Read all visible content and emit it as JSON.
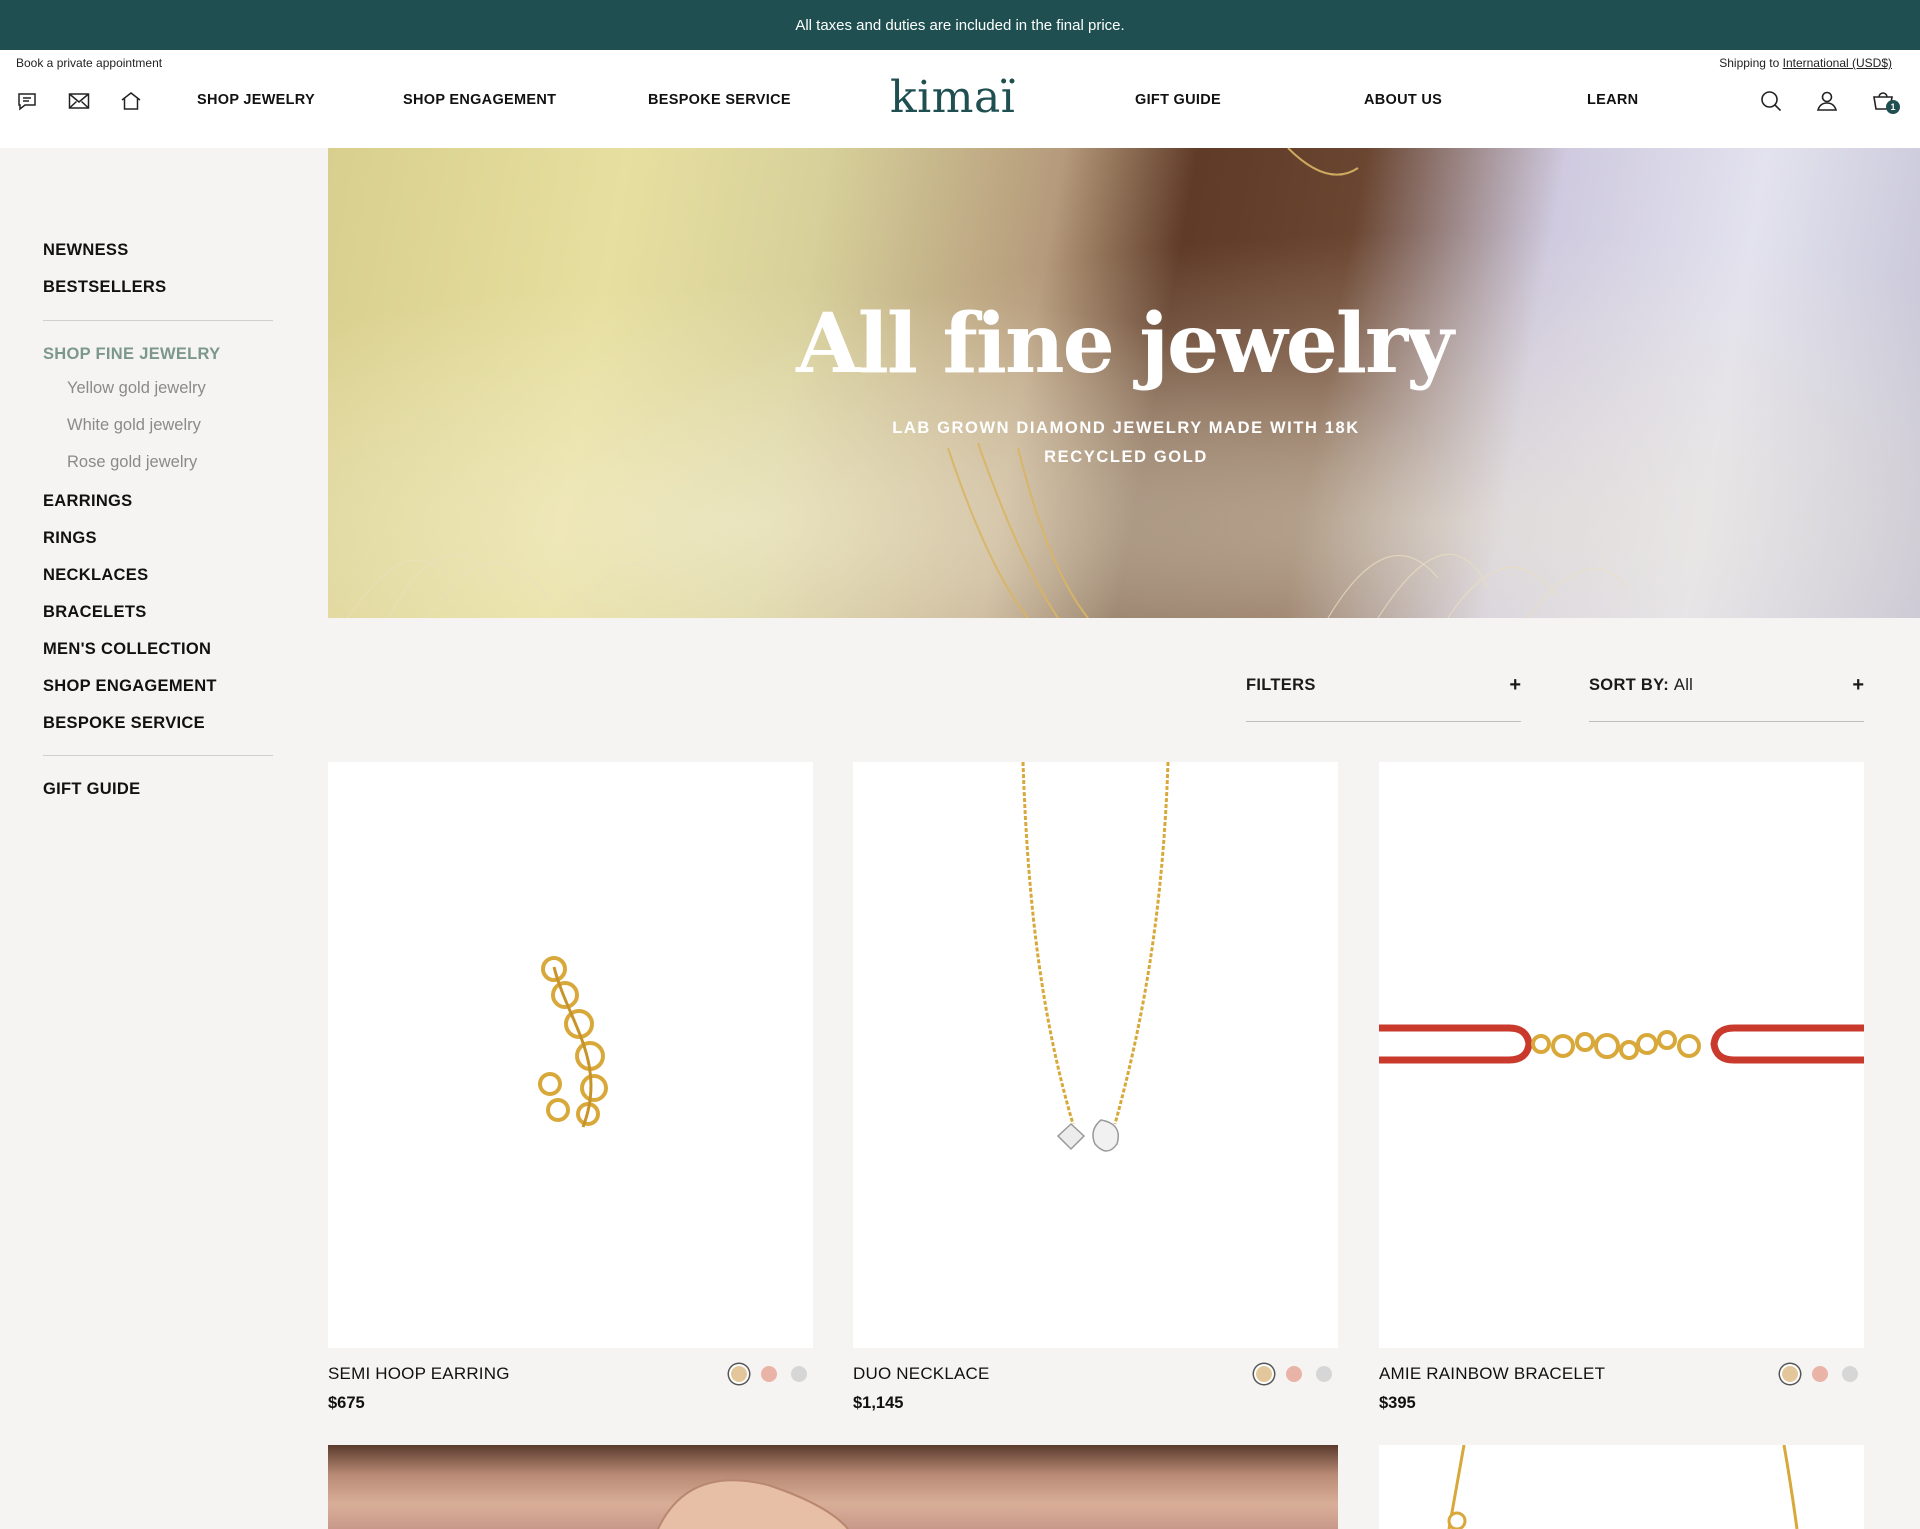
{
  "announcement": "All taxes and duties are included in the final price.",
  "header": {
    "appointment": "Book a private appointment",
    "shipping_prefix": "Shipping to",
    "shipping_region": "International (USD$)",
    "logo": "kimaï",
    "nav_left": [
      "SHOP JEWELRY",
      "SHOP ENGAGEMENT",
      "BESPOKE SERVICE"
    ],
    "nav_right": [
      "GIFT GUIDE",
      "ABOUT US",
      "LEARN"
    ],
    "cart_count": "1",
    "icons_left": [
      "chat-icon",
      "mail-icon",
      "home-icon"
    ],
    "icons_right": [
      "search-icon",
      "account-icon",
      "cart-icon"
    ]
  },
  "sidebar": {
    "top": [
      "NEWNESS",
      "BESTSELLERS"
    ],
    "section_title": "SHOP FINE JEWELRY",
    "sub_items": [
      "Yellow gold jewelry",
      "White gold jewelry",
      "Rose gold jewelry"
    ],
    "categories": [
      "EARRINGS",
      "RINGS",
      "NECKLACES",
      "BRACELETS",
      "MEN'S COLLECTION",
      "SHOP ENGAGEMENT",
      "BESPOKE SERVICE"
    ],
    "bottom": [
      "GIFT GUIDE"
    ]
  },
  "hero": {
    "title": "All fine jewelry",
    "subtitle": "LAB GROWN DIAMOND JEWELRY MADE WITH 18K RECYCLED GOLD"
  },
  "controls": {
    "filters_label": "FILTERS",
    "filters_icon": "+",
    "sort_label": "SORT BY:",
    "sort_value": "All",
    "sort_icon": "+"
  },
  "products": [
    {
      "name": "SEMI HOOP EARRING",
      "price": "$675"
    },
    {
      "name": "DUO NECKLACE",
      "price": "$1,145"
    },
    {
      "name": "AMIE RAINBOW BRACELET",
      "price": "$395"
    }
  ],
  "colors": {
    "brand": "#1f4f50",
    "accent_active": "#7c978c",
    "swatch_yellow": "#e3c79a",
    "swatch_rose": "#e9b4a7",
    "swatch_white": "#d6d6d6",
    "cord_red": "#c93a2c",
    "gold": "#d8a93a"
  }
}
